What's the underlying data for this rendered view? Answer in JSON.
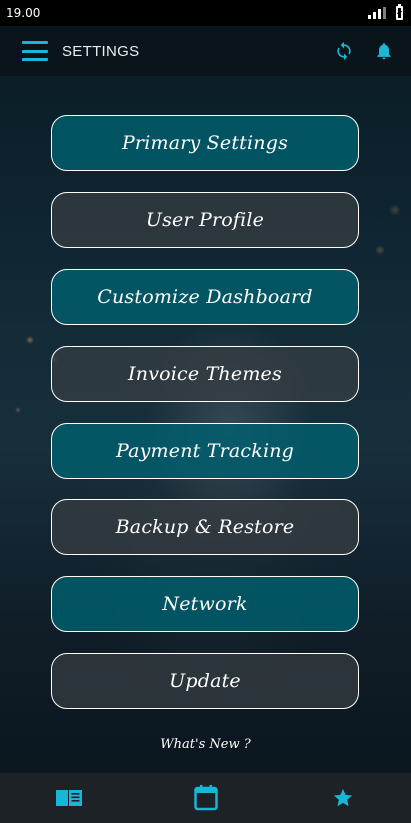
{
  "status_bar": {
    "time": "19.00"
  },
  "app_bar": {
    "title": "SETTINGS"
  },
  "colors": {
    "accent": "#1ab6d6",
    "teal_button": "#005f6e",
    "dark_button": "#373e42"
  },
  "menu": {
    "items": [
      {
        "label": "Primary Settings",
        "style": "teal"
      },
      {
        "label": "User Profile",
        "style": "dark"
      },
      {
        "label": "Customize Dashboard",
        "style": "teal"
      },
      {
        "label": "Invoice Themes",
        "style": "dark"
      },
      {
        "label": "Payment Tracking",
        "style": "teal"
      },
      {
        "label": "Backup & Restore",
        "style": "dark"
      },
      {
        "label": "Network",
        "style": "teal"
      },
      {
        "label": "Update",
        "style": "dark"
      }
    ]
  },
  "footer_link": "What's New ?",
  "bottom_nav": {
    "items": [
      {
        "icon": "book-icon"
      },
      {
        "icon": "calendar-icon"
      },
      {
        "icon": "star-icon"
      }
    ]
  }
}
